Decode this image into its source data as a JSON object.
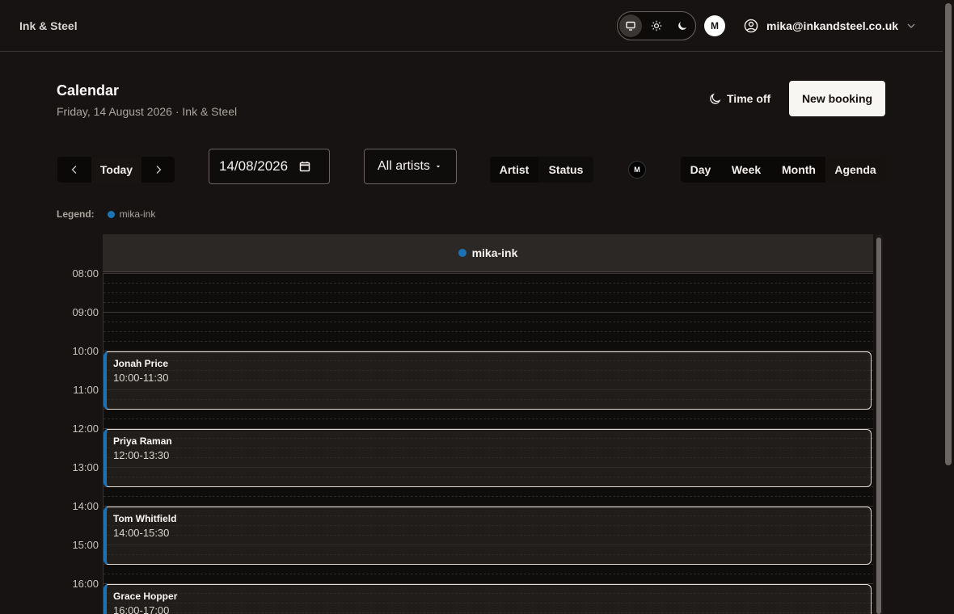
{
  "app": {
    "brand": "Ink & Steel"
  },
  "topbar": {
    "theme_options": [
      {
        "name": "system",
        "icon": "monitor-icon"
      },
      {
        "name": "light",
        "icon": "sun-icon"
      },
      {
        "name": "dark",
        "icon": "moon-icon"
      }
    ],
    "avatar_initial": "M",
    "user_email": "mika@inkandsteel.co.uk"
  },
  "header": {
    "title": "Calendar",
    "subtitle": "Friday, 14 August 2026 · Ink & Steel",
    "time_off_label": "Time off",
    "new_booking_label": "New booking"
  },
  "toolbar": {
    "today_label": "Today",
    "date_value": "14/08/2026",
    "artist_filter": "All artists",
    "group_by": [
      "Artist",
      "Status"
    ],
    "artist_avatar_initial": "M",
    "views": [
      "Day",
      "Week",
      "Month",
      "Agenda"
    ]
  },
  "legend": {
    "label": "Legend:",
    "items": [
      {
        "name": "mika-ink",
        "color": "#1b73b5"
      }
    ]
  },
  "calendar": {
    "column": {
      "name": "mika-ink",
      "color": "#1b73b5"
    },
    "hours": [
      "08:00",
      "09:00",
      "10:00",
      "11:00",
      "12:00",
      "13:00",
      "14:00",
      "15:00",
      "16:00"
    ],
    "events": [
      {
        "client": "Jonah Price",
        "time": "10:00-11:30"
      },
      {
        "client": "Priya Raman",
        "time": "12:00-13:30"
      },
      {
        "client": "Tom Whitfield",
        "time": "14:00-15:30"
      },
      {
        "client": "Grace Hopper",
        "time": "16:00-17:00"
      }
    ]
  }
}
